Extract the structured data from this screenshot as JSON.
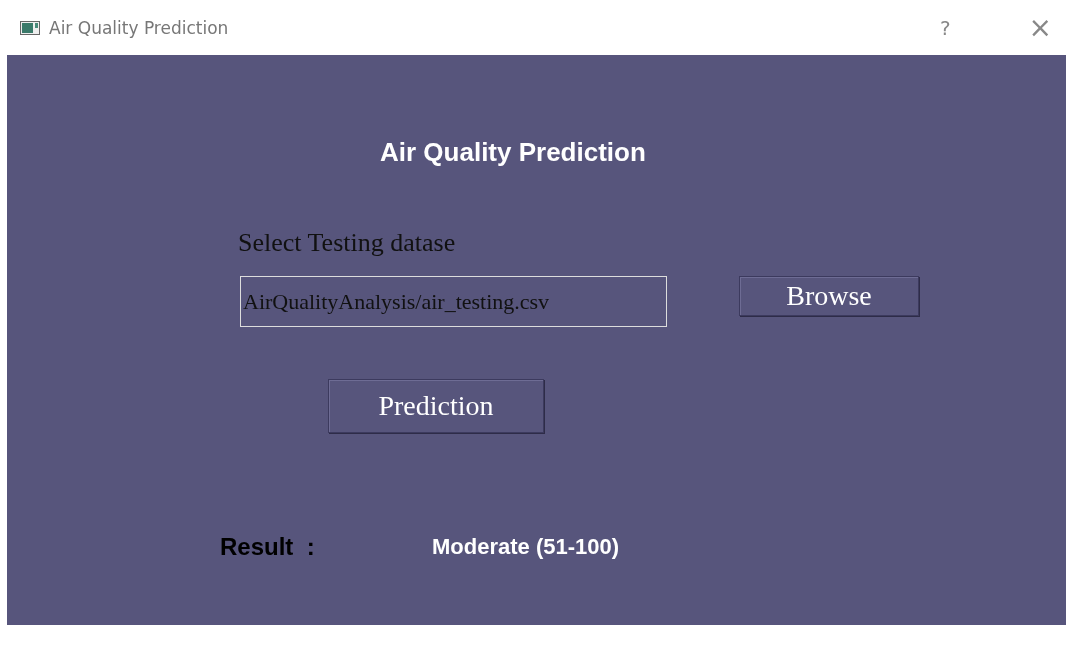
{
  "window": {
    "title": "Air Quality Prediction",
    "help": "?",
    "close": "×"
  },
  "heading": "Air Quality Prediction",
  "dataset_label": "Select Testing datase",
  "file_field": {
    "value": "AirQualityAnalysis/air_testing.csv"
  },
  "browse_button": "Browse",
  "predict_button": "Prediction",
  "result": {
    "label": "Result  :",
    "value": "Moderate (51-100)"
  }
}
